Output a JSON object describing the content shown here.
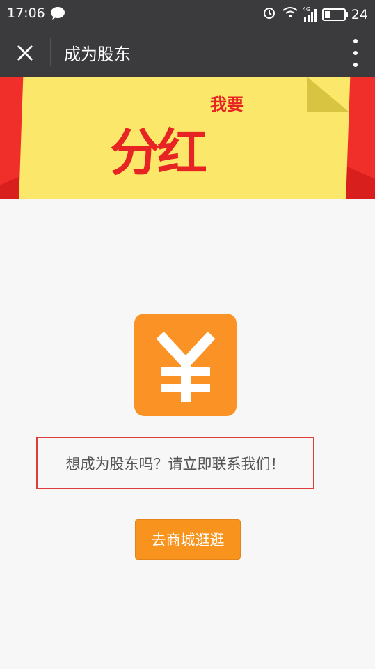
{
  "status_bar": {
    "time": "17:06",
    "network": "4G",
    "battery": "24"
  },
  "nav": {
    "title": "成为股东"
  },
  "banner": {
    "small_text": "我要",
    "big_text": "分红"
  },
  "content": {
    "message": "想成为股东吗？请立即联系我们！",
    "button_label": "去商城逛逛"
  },
  "colors": {
    "accent": "#fb9226",
    "highlight_border": "#e23c3c",
    "nav_background": "#3b3b3d"
  }
}
